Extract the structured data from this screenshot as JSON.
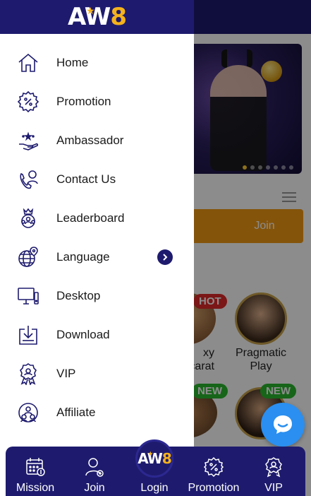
{
  "brand": {
    "logo_main": "AW",
    "logo_accent": "8",
    "primary_color": "#1e1b6e",
    "accent_color": "#f6b21b"
  },
  "background": {
    "join_label": "Join",
    "badges": {
      "hot": "HOT",
      "new1": "NEW",
      "new2": "NEW"
    },
    "cards": {
      "left_label": "xy\ncarat",
      "right_label": "Pragmatic Play"
    },
    "banner_colors": {
      "join": "#f39a14",
      "chat": "#2a8ff0"
    }
  },
  "drawer": {
    "items": [
      {
        "label": "Home",
        "icon": "home-icon"
      },
      {
        "label": "Promotion",
        "icon": "promotion-percent-icon"
      },
      {
        "label": "Ambassador",
        "icon": "ambassador-hand-star-icon"
      },
      {
        "label": "Contact Us",
        "icon": "contact-phone-icon"
      },
      {
        "label": "Leaderboard",
        "icon": "leaderboard-crown-icon"
      },
      {
        "label": "Language",
        "icon": "language-globe-icon",
        "has_arrow": true
      },
      {
        "label": "Desktop",
        "icon": "desktop-monitor-icon"
      },
      {
        "label": "Download",
        "icon": "download-icon"
      },
      {
        "label": "VIP",
        "icon": "vip-medal-icon"
      },
      {
        "label": "Affiliate",
        "icon": "affiliate-people-icon"
      }
    ]
  },
  "bottom_nav": {
    "mission": "Mission",
    "join": "Join",
    "login": "Login",
    "promotion": "Promotion",
    "vip": "VIP"
  }
}
